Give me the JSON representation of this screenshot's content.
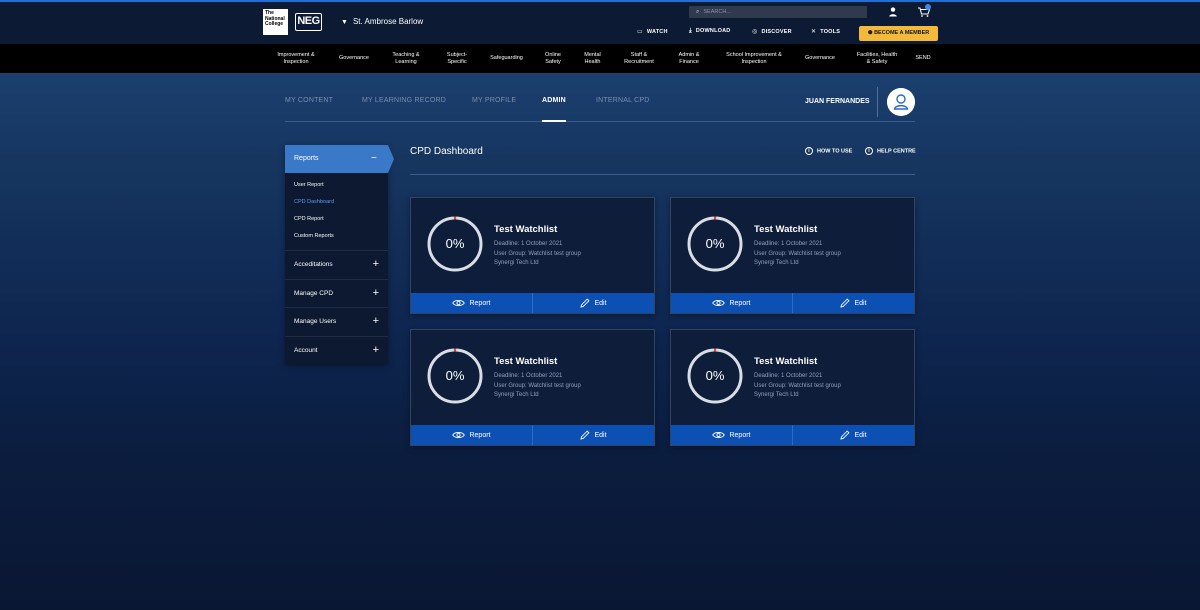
{
  "header": {
    "logo_tnc": "The National College",
    "logo_neg": "NEG",
    "school_name": "St. Ambrose Barlow",
    "search_placeholder": "SEARCH...",
    "links": {
      "watch": "WATCH",
      "download": "DOWNLOAD",
      "discover": "DISCOVER",
      "tools": "TOOLS"
    },
    "become_member": "BECOME A MEMBER",
    "icons": [
      "user-icon",
      "cart-icon",
      "search-icon"
    ]
  },
  "nav": {
    "items": [
      {
        "line1": "Improvement &",
        "line2": "Inspection"
      },
      {
        "line1": "Governance",
        "line2": ""
      },
      {
        "line1": "Teaching &",
        "line2": "Learning"
      },
      {
        "line1": "Subject-",
        "line2": "Specific"
      },
      {
        "line1": "Safeguarding",
        "line2": ""
      },
      {
        "line1": "Online",
        "line2": "Safety"
      },
      {
        "line1": "Mental",
        "line2": "Health"
      },
      {
        "line1": "Staff &",
        "line2": "Recruitment"
      },
      {
        "line1": "Admin &",
        "line2": "Finance"
      },
      {
        "line1": "School Improvement &",
        "line2": "Inspection"
      },
      {
        "line1": "Governance",
        "line2": ""
      },
      {
        "line1": "Facilities, Health",
        "line2": "& Safety"
      },
      {
        "line1": "SEND",
        "line2": ""
      }
    ]
  },
  "tabs": {
    "items": [
      "MY CONTENT",
      "MY LEARNING RECORD",
      "MY PROFILE",
      "ADMIN",
      "INTERNAL CPD"
    ],
    "active": "ADMIN",
    "user_name": "JUAN FERNANDES"
  },
  "sidebar": {
    "head": "Reports",
    "subitems": [
      "User Report",
      "CPD Dashboard",
      "CPD Report",
      "Custom Reports"
    ],
    "active_subitem": "CPD Dashboard",
    "items": [
      "Acceditations",
      "Manage CPD",
      "Manage Users",
      "Account"
    ]
  },
  "main": {
    "title": "CPD Dashboard",
    "how_to_use": "HOW TO USE",
    "help_centre": "HELP CENTRE"
  },
  "cards": [
    {
      "progress": "0%",
      "title": "Test Watchlist",
      "deadline": "Deadline: 1 October 2021",
      "group": "User Group: Watchlist test group",
      "org": "Synergi Tech Ltd",
      "report": "Report",
      "edit": "Edit"
    },
    {
      "progress": "0%",
      "title": "Test Watchlist",
      "deadline": "Deadline: 1 October 2021",
      "group": "User Group: Watchlist test group",
      "org": "Synergi Tech Ltd",
      "report": "Report",
      "edit": "Edit"
    },
    {
      "progress": "0%",
      "title": "Test Watchlist",
      "deadline": "Deadline: 1 October 2021",
      "group": "User Group: Watchlist test group",
      "org": "Synergi Tech Ltd",
      "report": "Report",
      "edit": "Edit"
    },
    {
      "progress": "0%",
      "title": "Test Watchlist",
      "deadline": "Deadline: 1 October 2021",
      "group": "User Group: Watchlist test group",
      "org": "Synergi Tech Ltd",
      "report": "Report",
      "edit": "Edit"
    }
  ],
  "colors": {
    "accent_blue": "#0d50b4",
    "sidebar_active": "#3a78c8",
    "member_button": "#f2b93a",
    "ring_track": "#d9dde4",
    "ring_mark": "#e04a4a"
  }
}
